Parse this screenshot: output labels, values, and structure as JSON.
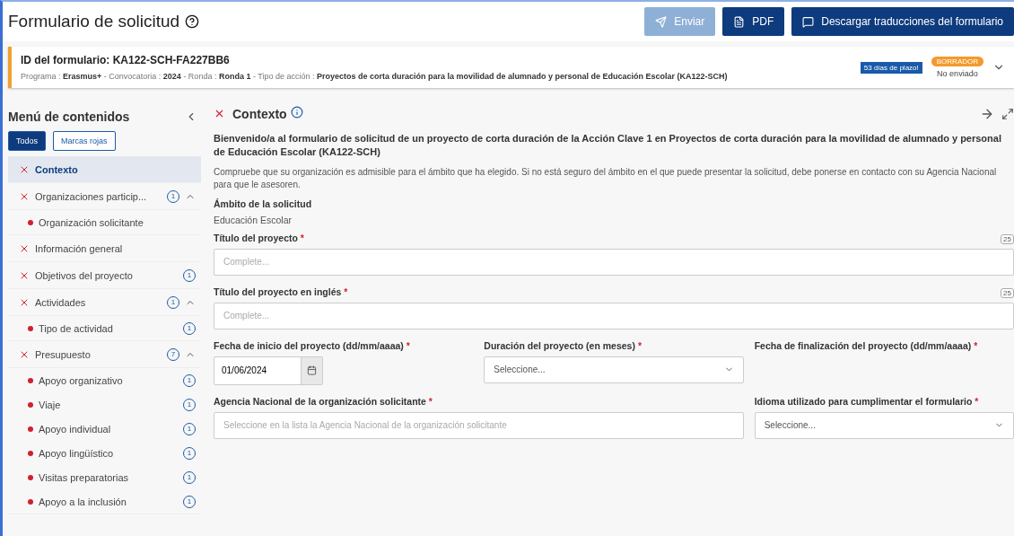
{
  "header": {
    "title": "Formulario de solicitud",
    "buttons": [
      {
        "label": "Enviar",
        "kind": "send",
        "disabled": true
      },
      {
        "label": "PDF",
        "kind": "pdf",
        "disabled": false
      },
      {
        "label": "Descargar traducciones del formulario",
        "kind": "translations",
        "disabled": false
      }
    ]
  },
  "form_info": {
    "id_label": "ID del formulario:",
    "id_value": "KA122-SCH-FA227BB6",
    "meta": "Programa : **Erasmus+** - Convocatoria : **2024** - Ronda : **Ronda 1** - Tipo de acción : **Proyectos de corta duración para la movilidad de alumnado y personal de Educación Escolar (KA122-SCH)**",
    "deadline": "53 días de plazo!",
    "status": "BORRADOR",
    "submission": "No enviado"
  },
  "sidebar": {
    "title": "Menú de contenidos",
    "filters": [
      {
        "label": "Todos",
        "selected": true
      },
      {
        "label": "Marcas rojas",
        "selected": false
      }
    ],
    "items": [
      {
        "label": "Contexto",
        "selected": true
      },
      {
        "label": "Organizaciones particip...",
        "selected": false,
        "count": "1",
        "expanded": true,
        "children": [
          {
            "label": "Organización solicitante",
            "selected": false
          }
        ]
      },
      {
        "label": "Información general",
        "selected": false
      },
      {
        "label": "Objetivos del proyecto",
        "selected": false,
        "count": "1"
      },
      {
        "label": "Actividades",
        "selected": false,
        "count": "1",
        "expanded": true,
        "children": [
          {
            "label": "Tipo de actividad",
            "selected": false,
            "count": "1"
          }
        ]
      },
      {
        "label": "Presupuesto",
        "selected": false,
        "count": "7",
        "expanded": true,
        "children": [
          {
            "label": "Apoyo organizativo",
            "selected": false,
            "count": "1"
          },
          {
            "label": "Viaje",
            "selected": false,
            "count": "1"
          },
          {
            "label": "Apoyo individual",
            "selected": false,
            "count": "1"
          },
          {
            "label": "Apoyo lingüístico",
            "selected": false,
            "count": "1"
          },
          {
            "label": "Visitas preparatorias",
            "selected": false,
            "count": "1"
          },
          {
            "label": "Apoyo a la inclusión",
            "selected": false,
            "count": "1"
          }
        ]
      }
    ]
  },
  "section": {
    "title": "Contexto",
    "intro": "Bienvenido/a al formulario de solicitud de un proyecto de corta duración de la Acción Clave 1 en Proyectos de corta duración para la movilidad de alumnado y personal de Educación Escolar (KA122-SCH)",
    "note": "Compruebe que su organización es admisible para el ámbito que ha elegido. Si no está seguro del ámbito en el que puede presentar la solicitud, debe ponerse en contacto con su Agencia Nacional para que le asesoren.",
    "scope_label": "Ámbito de la solicitud",
    "scope_value": "Educación Escolar",
    "fields": [
      {
        "kind": "text",
        "label": "Título del proyecto",
        "required_mark": "*",
        "placeholder": "Complete...",
        "counter": "25"
      },
      {
        "kind": "text",
        "label": "Título del proyecto en inglés",
        "required_mark": "*",
        "placeholder": "Complete...",
        "counter": "25"
      },
      {
        "kind": "date",
        "label": "Fecha de inicio del proyecto (dd/mm/aaaa)",
        "required_mark": "*",
        "value": "01/06/2024"
      },
      {
        "kind": "select",
        "label": "Duración del proyecto (en meses)",
        "required_mark": "*",
        "placeholder": "Seleccione..."
      },
      {
        "kind": "label",
        "label": "Fecha de finalización del proyecto (dd/mm/aaaa)",
        "required_mark": "*"
      },
      {
        "kind": "wide-text",
        "label": "Agencia Nacional de la organización solicitante",
        "required_mark": "*",
        "placeholder": "Seleccione en la lista la Agencia Nacional de la organización solicitante"
      },
      {
        "kind": "select",
        "label": "Idioma utilizado para cumplimentar el formulario",
        "required_mark": "*",
        "placeholder": "Seleccione..."
      }
    ]
  }
}
